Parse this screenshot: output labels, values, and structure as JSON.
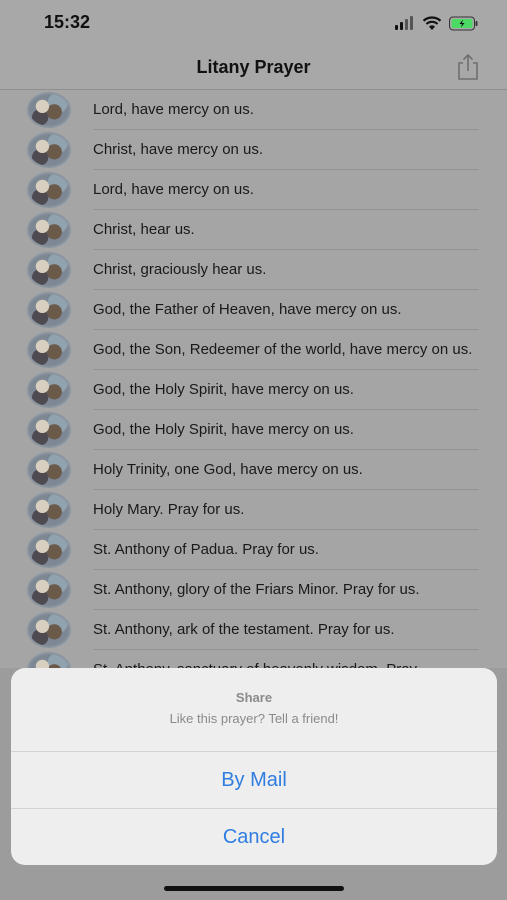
{
  "status": {
    "time": "15:32"
  },
  "nav": {
    "title": "Litany Prayer",
    "share_icon": "share-icon"
  },
  "prayers": [
    "Lord, have mercy on us.",
    "Christ, have mercy on us.",
    "Lord, have mercy on us.",
    "Christ, hear us.",
    "Christ, graciously hear us.",
    "God, the Father of Heaven, have mercy on us.",
    "God, the Son, Redeemer of the world, have mercy on us.",
    "God, the Holy Spirit, have mercy on us.",
    "God, the Holy Spirit, have mercy on us.",
    "Holy Trinity, one God, have mercy on us.",
    "Holy Mary. Pray for us.",
    "St. Anthony of Padua. Pray for us.",
    "St. Anthony, glory of the Friars Minor. Pray for us.",
    "St. Anthony, ark of the testament. Pray for us.",
    "St. Anthony, sanctuary of heavenly wisdom. Pray"
  ],
  "action_sheet": {
    "title": "Share",
    "message": "Like this prayer? Tell a friend!",
    "mail_label": "By Mail",
    "cancel_label": "Cancel"
  },
  "colors": {
    "accent": "#2f7de0"
  }
}
